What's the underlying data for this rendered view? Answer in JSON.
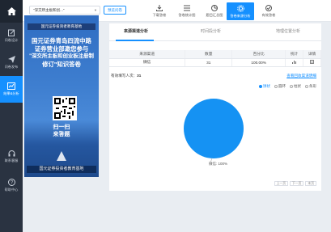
{
  "sidebar": {
    "items": [
      {
        "label": "问卷设计",
        "icon": "edit-icon"
      },
      {
        "label": "问卷发布",
        "icon": "send-icon"
      },
      {
        "label": "结果&分析",
        "icon": "chart-icon",
        "active": true
      }
    ],
    "bottom": [
      {
        "label": "联系客服",
        "icon": "headset-icon"
      },
      {
        "label": "帮助中心",
        "icon": "help-icon"
      }
    ]
  },
  "topbar": {
    "survey_select": "\"深交所主板和创...\"",
    "preview_label": "预览问卷",
    "tools": [
      {
        "label": "下载答卷",
        "icon": "download-icon"
      },
      {
        "label": "答卷统计图",
        "icon": "list-icon"
      },
      {
        "label": "题目汇总图",
        "icon": "pie-icon"
      },
      {
        "label": "答卷来源分析",
        "icon": "settings-icon",
        "active": true
      },
      {
        "label": "有效答卷",
        "icon": "check-icon"
      }
    ]
  },
  "poster": {
    "org": "国元证券投资者教育基地",
    "headline": [
      "国元证券青岛四流中路",
      "证券营业部邀您参与",
      "\"深交所主板和创业板注册制",
      "修订\"知识答卷"
    ],
    "slogan": [
      "扫一扫",
      "来答题"
    ],
    "base": "国元证券投资者教育基地"
  },
  "tabs": [
    "来源渠道分析",
    "时间段分析",
    "地理位置分析"
  ],
  "table": {
    "headers": [
      "来源渠道",
      "数量",
      "百分比",
      "统计",
      "详情"
    ],
    "rows": [
      {
        "channel": "微信",
        "count": "31",
        "percent": "100.00%"
      }
    ]
  },
  "valid_count_label": "有效填写人次：",
  "valid_count": "31",
  "link_label": "查看回收渠道明细",
  "chart_types": [
    "饼状",
    "圆环",
    "柱状",
    "条形"
  ],
  "chart_data": {
    "type": "pie",
    "categories": [
      "微信"
    ],
    "values": [
      100
    ],
    "labels": [
      "微信: 100%"
    ],
    "colors": [
      "#1592f3"
    ]
  },
  "paging": [
    "上一页",
    "下一页",
    "末页"
  ]
}
